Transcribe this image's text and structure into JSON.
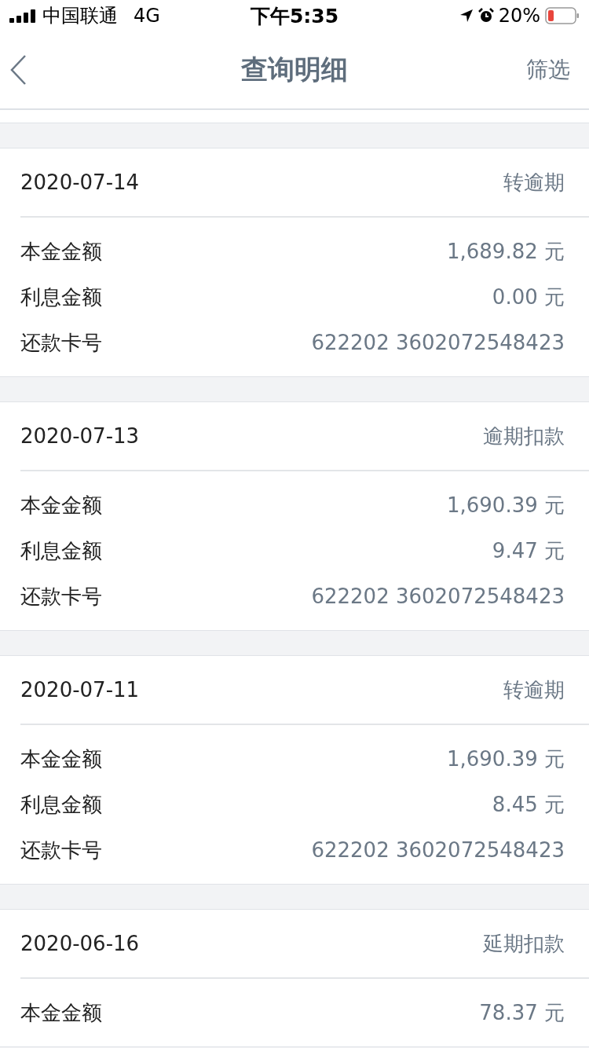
{
  "status_bar": {
    "carrier": "中国联通",
    "network": "4G",
    "time": "下午5:35",
    "battery": "20%"
  },
  "nav": {
    "title": "查询明细",
    "action": "筛选"
  },
  "records": [
    {
      "date": "2020-07-14",
      "status": "转逾期",
      "rows": [
        {
          "label": "本金金额",
          "value": "1,689.82 元"
        },
        {
          "label": "利息金额",
          "value": "0.00 元"
        },
        {
          "label": "还款卡号",
          "value": "622202 3602072548423"
        }
      ]
    },
    {
      "date": "2020-07-13",
      "status": "逾期扣款",
      "rows": [
        {
          "label": "本金金额",
          "value": "1,690.39 元"
        },
        {
          "label": "利息金额",
          "value": "9.47 元"
        },
        {
          "label": "还款卡号",
          "value": "622202 3602072548423"
        }
      ]
    },
    {
      "date": "2020-07-11",
      "status": "转逾期",
      "rows": [
        {
          "label": "本金金额",
          "value": "1,690.39 元"
        },
        {
          "label": "利息金额",
          "value": "8.45 元"
        },
        {
          "label": "还款卡号",
          "value": "622202 3602072548423"
        }
      ]
    },
    {
      "date": "2020-06-16",
      "status": "延期扣款",
      "rows": [
        {
          "label": "本金金额",
          "value": "78.37 元"
        }
      ]
    }
  ]
}
